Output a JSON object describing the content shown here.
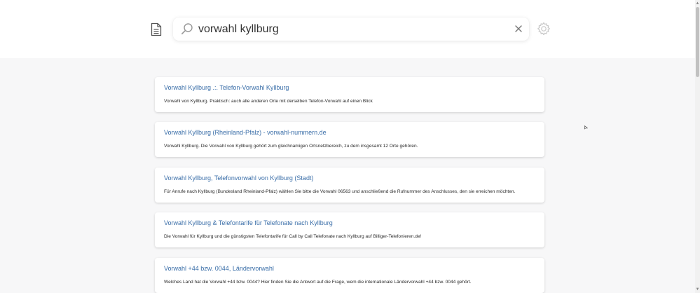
{
  "search": {
    "query": "vorwahl kyllburg"
  },
  "icons": {
    "document": "document-icon",
    "search": "search-icon",
    "clear": "close-icon",
    "settings": "gear-icon"
  },
  "colors": {
    "link": "#3a6ea8",
    "background": "#f7f7f8",
    "card": "#ffffff"
  },
  "results": [
    {
      "title": "Vorwahl Kyllburg .:. Telefon-Vorwahl Kyllburg",
      "snippet": "Vorwahl von Kyllburg. Praktisch: auch alle anderen Orte mit derselben Telefon-Vorwahl auf einen Blick"
    },
    {
      "title": "Vorwahl Kyllburg (Rheinland-Pfalz) - vorwahl-nummern.de",
      "snippet": "Vorwahl Kyllburg. Die Vorwahl von Kyllburg gehört zum gleichnamigen Ortsnetzbereich, zu dem insgesamt 12 Orte gehören."
    },
    {
      "title": "Vorwahl Kyllburg, Telefonvorwahl von Kyllburg (Stadt)",
      "snippet": "Für Anrufe nach Kyllburg (Bundesland Rheinland-Pfalz) wählen Sie bitte die Vorwahl 06563 und anschließend die Rufnummer des Anschlusses, den sie erreichen möchten."
    },
    {
      "title": "Vorwahl Kyllburg & Telefontarife für Telefonate nach Kyllburg",
      "snippet": "Die Vorwahl für Kyllburg und die günstigsten Telefontarife für Call by Call Telefonate nach Kyllburg auf Billiger-Telefonieren.de!"
    },
    {
      "title": "Vorwahl +44 bzw. 0044, Ländervorwahl",
      "snippet": "Welches Land hat die Vorwahl +44 bzw. 0044? Hier finden Sie die Antwort auf die Frage, wem die internationale Ländervorwahl +44 bzw. 0044 gehört."
    }
  ]
}
